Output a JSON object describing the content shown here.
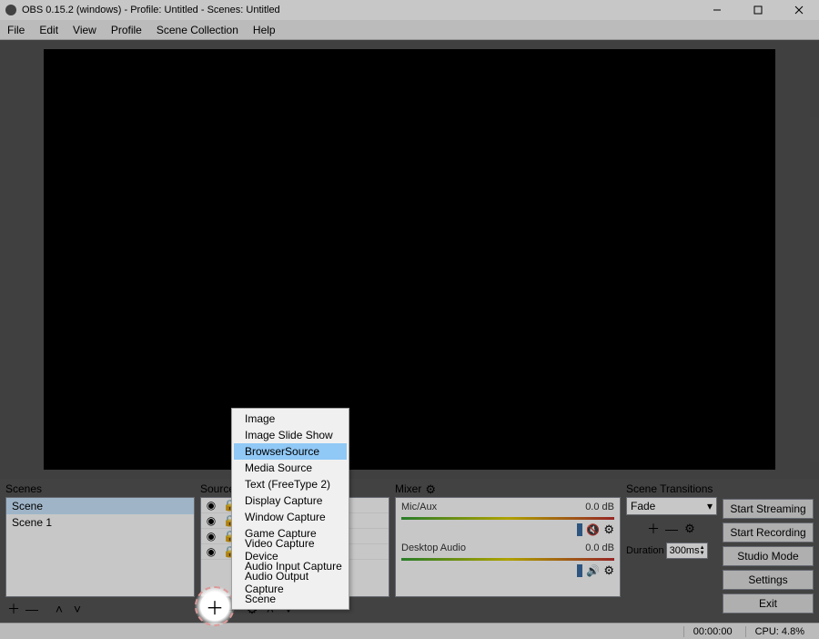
{
  "window": {
    "title": "OBS 0.15.2 (windows) - Profile: Untitled - Scenes: Untitled",
    "controls": [
      "minimize",
      "maximize",
      "close"
    ]
  },
  "menu": [
    "File",
    "Edit",
    "View",
    "Profile",
    "Scene Collection",
    "Help"
  ],
  "panels": {
    "scenes_label": "Scenes",
    "sources_label": "Sources",
    "mixer_label": "Mixer",
    "transitions_label": "Scene Transitions"
  },
  "scenes": {
    "items": [
      "Scene",
      "Scene 1"
    ],
    "selected_index": 0
  },
  "sources": {
    "rows": [
      "",
      "",
      "",
      ""
    ]
  },
  "mixer": {
    "items": [
      {
        "name": "Mic/Aux",
        "db": "0.0 dB",
        "muted": true
      },
      {
        "name": "Desktop Audio",
        "db": "0.0 dB",
        "muted": false
      }
    ]
  },
  "transitions": {
    "selected": "Fade",
    "duration_label": "Duration",
    "duration_value": "300ms"
  },
  "buttons": {
    "start_streaming": "Start Streaming",
    "start_recording": "Start Recording",
    "studio_mode": "Studio Mode",
    "settings": "Settings",
    "exit": "Exit"
  },
  "status": {
    "time": "00:00:00",
    "cpu": "CPU: 4.8%"
  },
  "popup": {
    "items": [
      "Image",
      "Image Slide Show",
      "BrowserSource",
      "Media Source",
      "Text (FreeType 2)",
      "Display Capture",
      "Window Capture",
      "Game Capture",
      "Video Capture Device",
      "Audio Input Capture",
      "Audio Output Capture",
      "Scene"
    ],
    "highlighted_index": 2
  },
  "icons": {
    "gear": "⚙",
    "plus": "＋",
    "minus": "—",
    "up": "˄",
    "down": "˅",
    "eye": "◉",
    "lock": "🔒",
    "mute": "🔇",
    "speaker": "🔊",
    "dropdown": "▾",
    "spin_up": "▲",
    "spin_down": "▼"
  }
}
